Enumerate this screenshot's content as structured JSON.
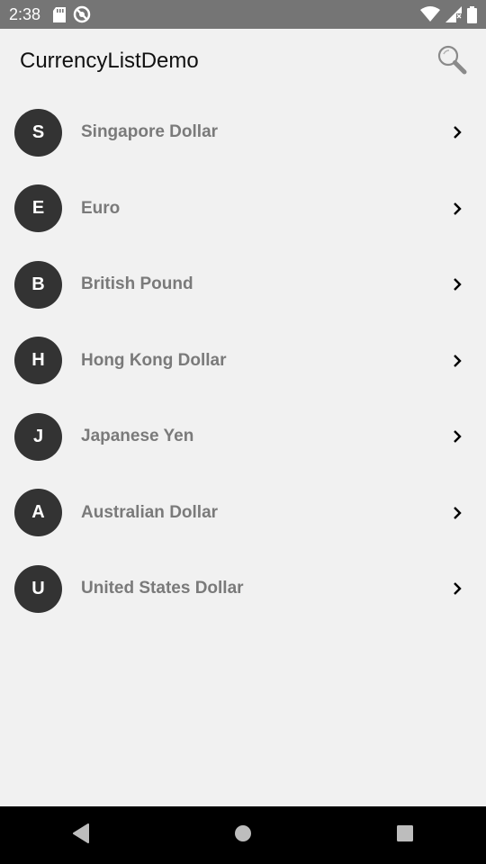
{
  "status_bar": {
    "time": "2:38",
    "left_icons": [
      "sd-card-icon",
      "no-disturb-icon"
    ],
    "right_icons": [
      "wifi-icon",
      "signal-icon",
      "battery-icon"
    ]
  },
  "app_bar": {
    "title": "CurrencyListDemo",
    "action_icon": "search-icon"
  },
  "currencies": [
    {
      "initial": "S",
      "name": "Singapore Dollar"
    },
    {
      "initial": "E",
      "name": "Euro"
    },
    {
      "initial": "B",
      "name": "British Pound"
    },
    {
      "initial": "H",
      "name": "Hong Kong Dollar"
    },
    {
      "initial": "J",
      "name": "Japanese Yen"
    },
    {
      "initial": "A",
      "name": "Australian Dollar"
    },
    {
      "initial": "U",
      "name": "United States Dollar"
    }
  ],
  "nav_bar": {
    "buttons": [
      "back-icon",
      "home-icon",
      "recents-icon"
    ]
  },
  "colors": {
    "status_bar": "#757575",
    "background": "#f1f1f1",
    "avatar": "#333333",
    "item_text": "#7a7a7a",
    "nav_bar": "#000000"
  }
}
